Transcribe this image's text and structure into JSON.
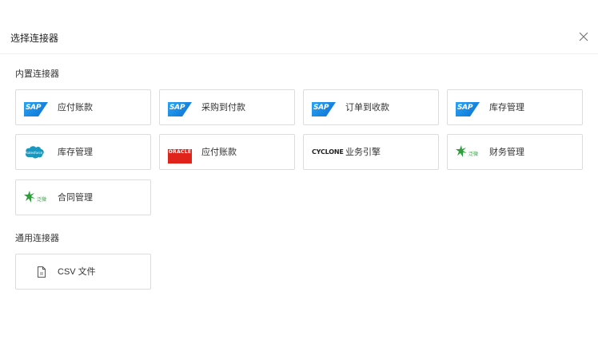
{
  "dialog": {
    "title": "选择连接器",
    "close_icon": "close-icon"
  },
  "builtin": {
    "label": "内置连接器",
    "cards": [
      {
        "logo": "SAP",
        "logo_icon": "sap-logo",
        "label": "应付账款"
      },
      {
        "logo": "SAP",
        "logo_icon": "sap-logo",
        "label": "采购到付款"
      },
      {
        "logo": "SAP",
        "logo_icon": "sap-logo",
        "label": "订单到收款"
      },
      {
        "logo": "SAP",
        "logo_icon": "sap-logo",
        "label": "库存管理"
      },
      {
        "logo": "salesforce",
        "logo_icon": "salesforce-logo",
        "label": "库存管理"
      },
      {
        "logo": "ORACLE",
        "logo_icon": "oracle-logo",
        "label": "应付账款"
      },
      {
        "logo": "CYCLONE",
        "logo_icon": "cyclone-logo",
        "label": "业务引擎"
      },
      {
        "logo": "泛微",
        "logo_icon": "weaver-logo",
        "label": "财务管理"
      },
      {
        "logo": "泛微",
        "logo_icon": "weaver-logo",
        "label": "合同管理"
      }
    ]
  },
  "generic": {
    "label": "通用连接器",
    "cards": [
      {
        "logo_icon": "file-icon",
        "label": "CSV 文件"
      }
    ]
  },
  "colors": {
    "sap_blue": "#0a6ed1",
    "salesforce_blue": "#1798c1",
    "oracle_red": "#e0241b",
    "weaver_green": "#2e9e3c",
    "border": "#dcdcdc"
  }
}
